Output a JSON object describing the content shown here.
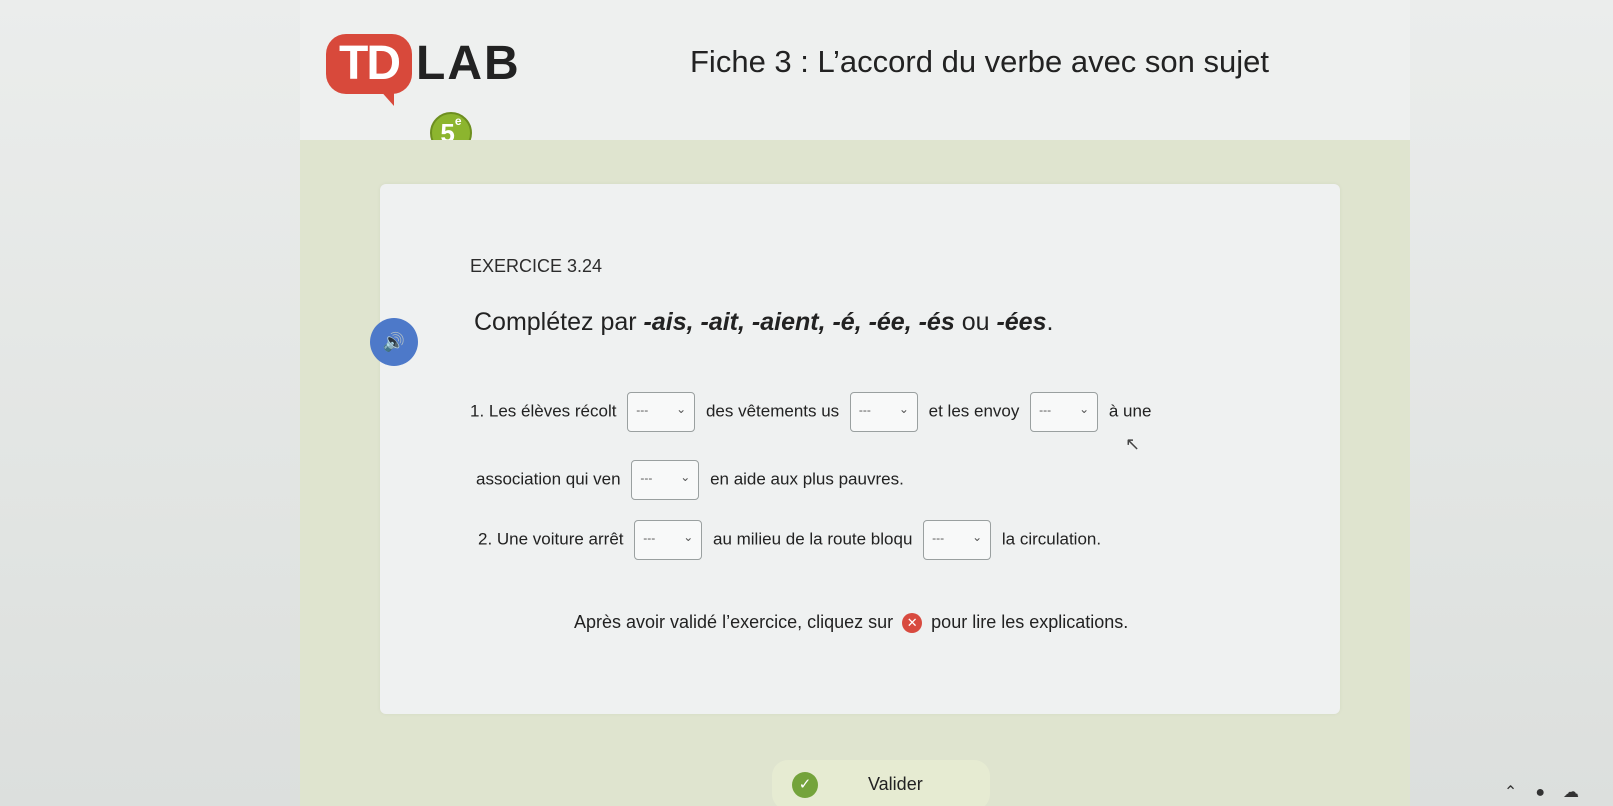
{
  "header": {
    "logo_td": "TD",
    "logo_lab": "LAB",
    "logo_grade": "5",
    "logo_grade_sup": "e",
    "sheet_title": "Fiche 3 : L’accord du verbe avec son sujet"
  },
  "exercise": {
    "id": "EXERCICE 3.24",
    "instruction_prefix": "Complétez par ",
    "instruction_endings": "-ais, -ait, -aient, -é, -ée, -és",
    "instruction_or": " ou ",
    "instruction_last": "-ées",
    "instruction_suffix": ".",
    "audio_icon": "speaker-icon",
    "select_placeholder": "---",
    "sentence1": {
      "part1": "1. Les élèves récolt",
      "part2": "des vêtements us",
      "part3": "et les envoy",
      "part4": "à une",
      "part5": "association qui ven",
      "part6": "en aide aux plus pauvres."
    },
    "sentence2": {
      "part1": "2. Une voiture arrêt",
      "part2": "au milieu de la route bloqu",
      "part3": "la circulation."
    },
    "note_before": "Après avoir validé l’exercice, cliquez sur",
    "note_after": "pour lire les explications."
  },
  "footer": {
    "validate_label": "Valider"
  }
}
